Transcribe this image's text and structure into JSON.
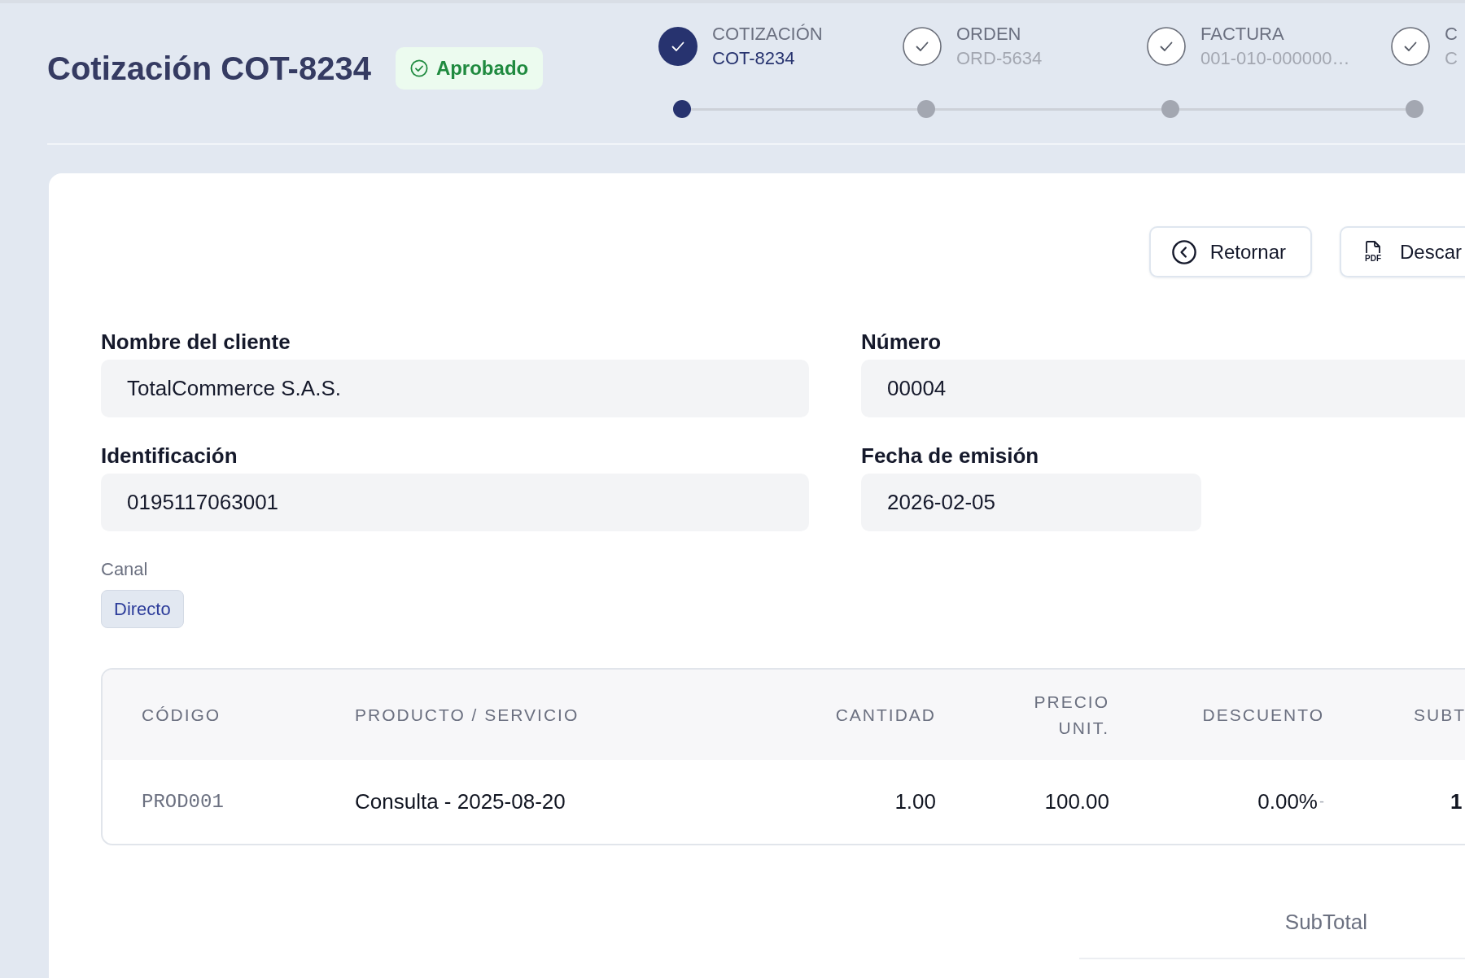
{
  "header": {
    "title": "Cotización COT-8234",
    "status": {
      "label": "Aprobado",
      "kind": "approved"
    },
    "steps": [
      {
        "label": "COTIZACIÓN",
        "reference": "COT-8234",
        "current": true
      },
      {
        "label": "ORDEN",
        "reference": "ORD-5634",
        "current": false
      },
      {
        "label": "FACTURA",
        "reference": "001-010-000000…",
        "current": false
      },
      {
        "label": "C",
        "reference": "C",
        "current": false
      }
    ]
  },
  "actions": [
    {
      "kind": "back",
      "label": "Retornar"
    },
    {
      "kind": "pdf",
      "label": "Descar",
      "icon_text": "PDF"
    }
  ],
  "form": {
    "fields": [
      {
        "kind": "text",
        "label": "Nombre del cliente",
        "value": "TotalCommerce S.A.S."
      },
      {
        "kind": "text",
        "label": "Número",
        "value": "00004"
      },
      {
        "kind": "text",
        "label": "Identificación",
        "value": "0195117063001"
      },
      {
        "kind": "date",
        "label": "Fecha de emisión",
        "value": "2026-02-05"
      }
    ],
    "channel": {
      "label": "Canal",
      "value": "Directo"
    }
  },
  "table": {
    "columns": [
      "CÓDIGO",
      "PRODUCTO / SERVICIO",
      "CANTIDAD",
      "PRECIO UNIT.",
      "DESCUENTO",
      "SUBT"
    ],
    "rows": [
      {
        "code": "PROD001",
        "product": "Consulta - 2025-08-20",
        "quantity": "1.00",
        "unit_price": "100.00",
        "discount": "0.00%",
        "discount_note": "-",
        "subtotal": "1"
      }
    ]
  },
  "totals": [
    {
      "label": "SubTotal"
    }
  ]
}
